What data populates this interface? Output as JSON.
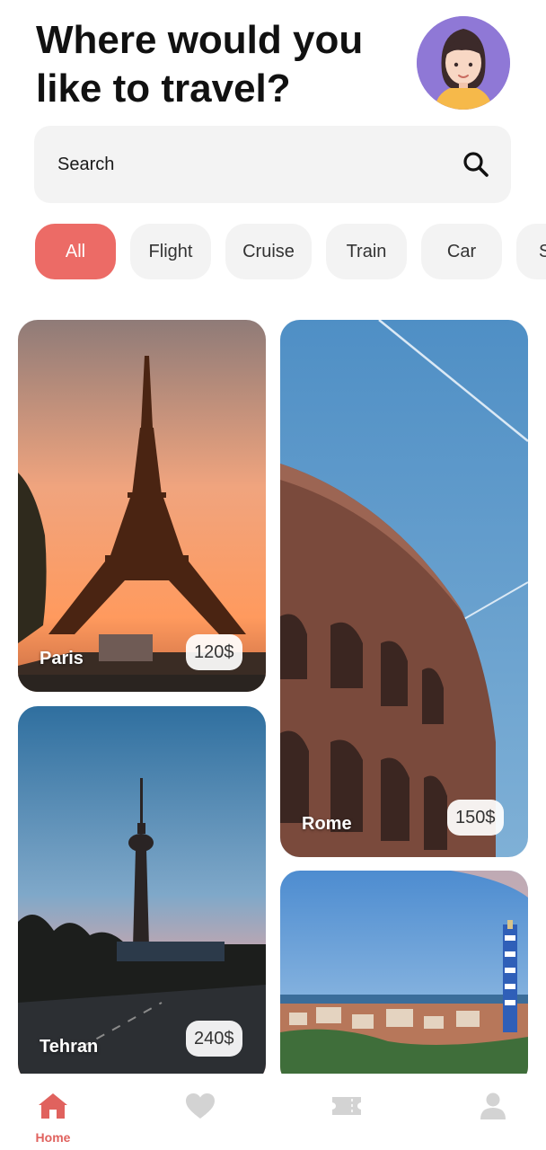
{
  "header": {
    "title": "Where would you\nlike to travel?"
  },
  "search": {
    "placeholder": "Search",
    "icon": "search-icon"
  },
  "categories": [
    {
      "label": "All",
      "active": true
    },
    {
      "label": "Flight",
      "active": false
    },
    {
      "label": "Cruise",
      "active": false
    },
    {
      "label": "Train",
      "active": false
    },
    {
      "label": "Car",
      "active": false
    },
    {
      "label": "S",
      "active": false
    }
  ],
  "destinations": [
    {
      "name": "Paris",
      "price": "120$"
    },
    {
      "name": "Rome",
      "price": "150$"
    },
    {
      "name": "Tehran",
      "price": "240$"
    },
    {
      "name": "",
      "price": ""
    }
  ],
  "bottom_nav": [
    {
      "label": "Home",
      "icon": "home-icon",
      "active": true
    },
    {
      "label": "",
      "icon": "heart-icon",
      "active": false
    },
    {
      "label": "",
      "icon": "ticket-icon",
      "active": false
    },
    {
      "label": "",
      "icon": "user-icon",
      "active": false
    }
  ],
  "colors": {
    "accent": "#ec6b66",
    "chip_background": "#f3f3f3",
    "nav_inactive": "#d3d3d3"
  }
}
